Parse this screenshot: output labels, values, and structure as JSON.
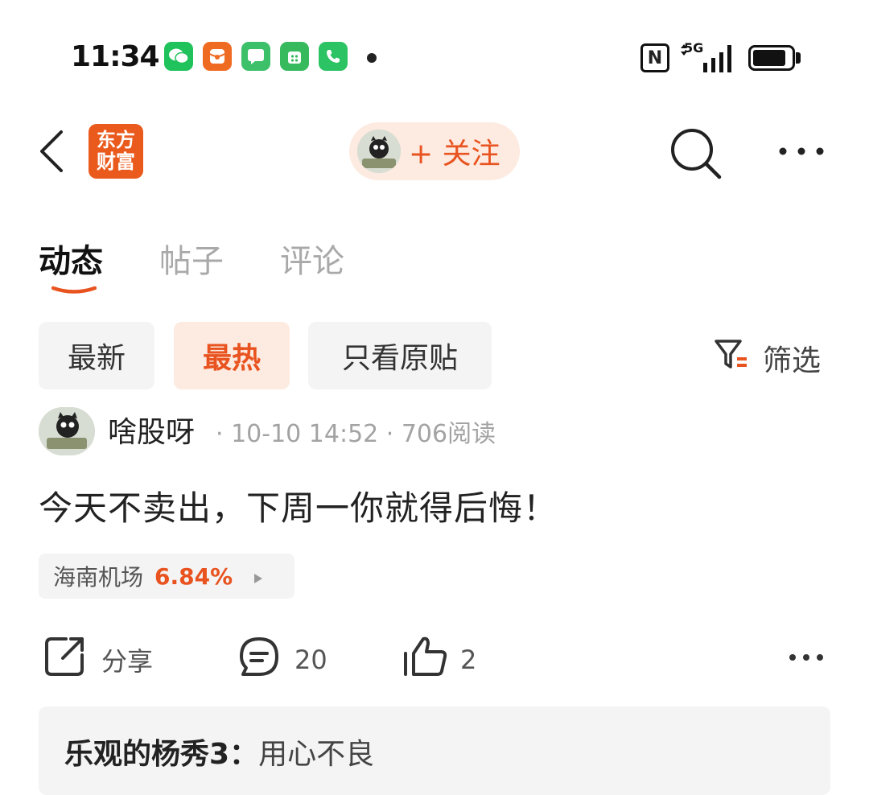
{
  "status_bar": {
    "time": "11:34",
    "notification_icons": [
      "wechat-icon",
      "red-packet-icon",
      "message-icon",
      "app-store-icon",
      "phone-icon"
    ],
    "network": "5G",
    "nfc_label": "N"
  },
  "header": {
    "logo_line1": "东方",
    "logo_line2": "财富",
    "follow_label": "+ 关注"
  },
  "tabs": [
    {
      "label": "动态",
      "active": true
    },
    {
      "label": "帖子",
      "active": false
    },
    {
      "label": "评论",
      "active": false
    }
  ],
  "filters": {
    "chips": [
      {
        "label": "最新",
        "active": false
      },
      {
        "label": "最热",
        "active": true
      },
      {
        "label": "只看原贴",
        "active": false
      }
    ],
    "filter_label": "筛选"
  },
  "post": {
    "author": "啥股呀",
    "meta": "· 10-10 14:52 · 706阅读",
    "content": "今天不卖出，下周一你就得后悔！",
    "stock": {
      "name": "海南机场",
      "change": "6.84%"
    },
    "actions": {
      "share": "分享",
      "comments": "20",
      "likes": "2"
    },
    "top_comment": {
      "user": "乐观的杨秀3：",
      "text": "用心不良"
    }
  },
  "colors": {
    "accent": "#e8531f",
    "brand": "#ea5a1c",
    "chip_bg": "#f4f4f5"
  }
}
